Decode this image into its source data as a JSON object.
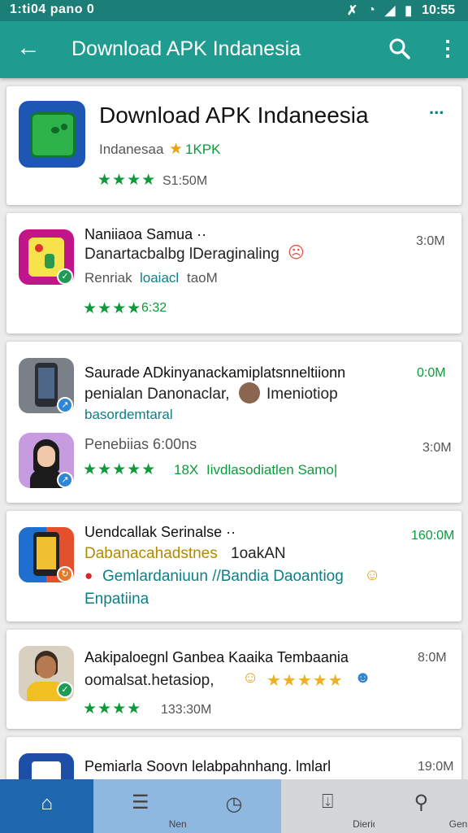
{
  "status": {
    "left": "1:ti04 pano 0",
    "time": "10:55"
  },
  "appbar": {
    "title": "Download APK Indanesia"
  },
  "header_card": {
    "title": "Download APK Indaneesia",
    "subtitle": "Indanesaa",
    "rating_tag": "1KPK",
    "stars": "★★★★",
    "size": "S1:50M",
    "more": "..."
  },
  "apps": [
    {
      "name": "Naniiaoa Samua ··",
      "line1": "Danartacbalbg lDeraginaling",
      "line2a": "Renriak",
      "line2b": "loaiacl",
      "line2c": "taoM",
      "stars": "★★★★",
      "rating": "6:32",
      "size": "3:0M"
    },
    {
      "name": "Saurade ADkinyanackamiplatsnneltiionn",
      "line1": "penialan Danonaclar,",
      "line1b": "Imeniotiop",
      "line2": "basordemtaral",
      "size": "0:0M"
    },
    {
      "name": "Penebiias 6:00ns",
      "stars": "★★★★★",
      "rating": "18X",
      "line1": "Iivdlasodiatlen Samo|",
      "size": "3:0M"
    },
    {
      "name": "Uendcallak Serinalse ··",
      "line1": "Dabanacahadstnes",
      "line1b": "1oakAN",
      "line2": "Gemlardaniuun //Bandia Daoantiog",
      "line3": "Enpatiina",
      "size": "160:0M"
    },
    {
      "name": "Aakipaloegnl Ganbea Kaaika Tembaania",
      "line1": "oomalsat.hetasiop,",
      "stars": "★★★★★",
      "stars2": "★★★★",
      "size2": "133:30M",
      "size": "8:0M"
    },
    {
      "name": "Pemiarla Soovn lelabpahnhang. lmlarl",
      "size": "19:0M"
    }
  ],
  "nav": [
    {
      "label": ""
    },
    {
      "label": "Nenrans"
    },
    {
      "label": ""
    },
    {
      "label": "Dierideins"
    },
    {
      "label": "Genreen"
    }
  ],
  "colors": {
    "appbar": "#1f9b8f",
    "statusbar": "#1b7f78",
    "star_green": "#0d9a3a",
    "nav_active": "#1e66ad"
  }
}
